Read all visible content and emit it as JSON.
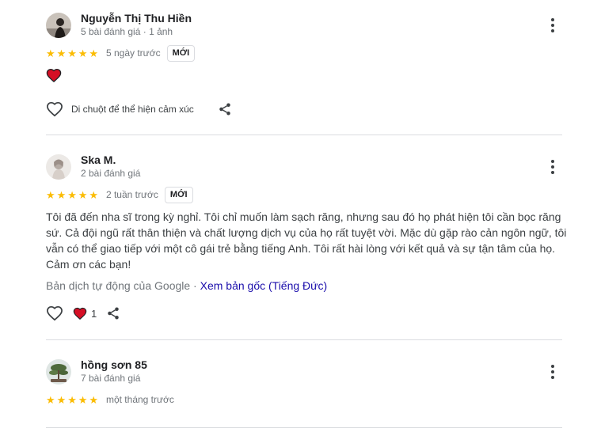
{
  "reviews": [
    {
      "name": "Nguyễn Thị Thu Hiền",
      "meta": "5 bài đánh giá · 1 ảnh",
      "rating": 5,
      "when": "5 ngày trước",
      "badge": "MỚI",
      "hover_hint": "Di chuột để thể hiện cảm xúc",
      "reaction_icon": "heart-icon"
    },
    {
      "name": "Ska M.",
      "meta": "2 bài đánh giá",
      "rating": 5,
      "when": "2 tuần trước",
      "badge": "MỚI",
      "text": "Tôi đã đến nha sĩ trong kỳ nghỉ. Tôi chỉ muốn làm sạch răng, nhưng sau đó họ phát hiện tôi cần bọc răng sứ. Cả đội ngũ rất thân thiện và chất lượng dịch vụ của họ rất tuyệt vời. Mặc dù gặp rào cản ngôn ngữ, tôi vẫn có thể giao tiếp với một cô gái trẻ bằng tiếng Anh. Tôi rất hài lòng với kết quả và sự tận tâm của họ. Cảm ơn các bạn!",
      "translation_note": "Bản dịch tự động của Google · ",
      "original_link": "Xem bản gốc (Tiếng Đức)",
      "like_count": "1"
    },
    {
      "name": "hồng sơn 85",
      "meta": "7 bài đánh giá",
      "rating": 5,
      "when": "một tháng trước"
    }
  ],
  "colors": {
    "star": "#fbbc04",
    "heart": "#d50f25",
    "link": "#1a0dab",
    "divider": "#dadce0"
  },
  "icons": [
    "more-vert-icon",
    "heart-outline-icon",
    "heart-filled-icon",
    "share-icon",
    "star-icon"
  ]
}
